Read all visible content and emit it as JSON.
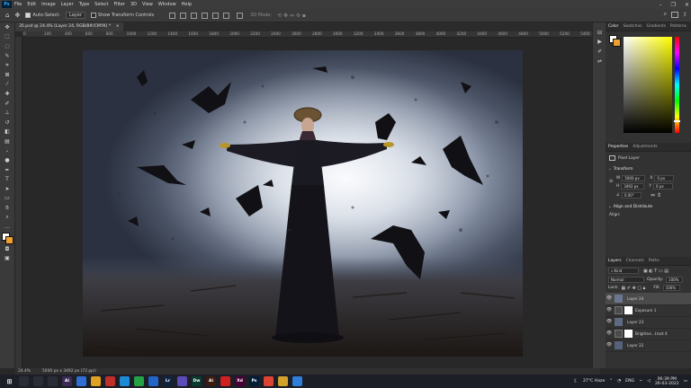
{
  "app": {
    "logo": "Ps",
    "menu": [
      "File",
      "Edit",
      "Image",
      "Layer",
      "Type",
      "Select",
      "Filter",
      "3D",
      "View",
      "Window",
      "Help"
    ],
    "window_controls": {
      "minimize": "–",
      "maximize": "❐",
      "close": "✕"
    }
  },
  "options_bar": {
    "auto_select_label": "Auto-Select:",
    "auto_select_value": "Layer",
    "show_transform_label": "Show Transform Controls",
    "mode_label": "3D Mode:"
  },
  "document": {
    "tab_title": "35.psd @ 24.4% (Layer 24, RGB/8#/CMYK) *",
    "close_symbol": "×",
    "ruler_labels": [
      "0",
      "200",
      "400",
      "600",
      "800",
      "1000",
      "1200",
      "1400",
      "1600",
      "1800",
      "2000",
      "2200",
      "2400",
      "2600",
      "2800",
      "3000",
      "3200",
      "3400",
      "3600",
      "3800",
      "4000",
      "4200",
      "4400",
      "4600",
      "4800",
      "5000",
      "5200",
      "5400"
    ]
  },
  "status": {
    "zoom": "24.4%",
    "size": "5000 px x 3492 px (72 ppi)"
  },
  "color_panel": {
    "tabs": [
      "Color",
      "Swatches",
      "Gradients",
      "Patterns"
    ],
    "fg_color": "#ffffff",
    "bg_color": "#f0a030",
    "hue_color": "#ffff00"
  },
  "properties_panel": {
    "tabs": [
      "Properties",
      "Adjustments"
    ],
    "layer_kind": "Pixel Layer",
    "transform_label": "Transform",
    "w_label": "W",
    "w_value": "5000 px",
    "h_label": "H",
    "h_value": "3492 px",
    "x_label": "X",
    "x_value": "0 px",
    "y_label": "Y",
    "y_value": "0 px",
    "angle_value": "0.00°",
    "align_label": "Align and Distribute",
    "align_sub": "Align:"
  },
  "layers_panel": {
    "tabs": [
      "Layers",
      "Channels",
      "Paths"
    ],
    "kind_label": "Kind",
    "blend_mode": "Normal",
    "opacity_label": "Opacity:",
    "opacity_value": "100%",
    "lock_label": "Lock:",
    "fill_label": "Fill:",
    "fill_value": "100%",
    "layers": [
      {
        "name": "Layer 24",
        "selected": true
      },
      {
        "name": "Exposure 1",
        "selected": false
      },
      {
        "name": "Layer 23",
        "selected": false
      },
      {
        "name": "Brightne...trast 4",
        "selected": false
      },
      {
        "name": "Layer 22",
        "selected": false
      }
    ]
  },
  "taskbar": {
    "apps": [
      {
        "label": "",
        "color": "#2a2d36"
      },
      {
        "label": "",
        "color": "#2a2d36"
      },
      {
        "label": "",
        "color": "#2a2d36"
      },
      {
        "label": "Ai",
        "color": "#3a2a55"
      },
      {
        "label": "",
        "color": "#2f6fd3"
      },
      {
        "label": "",
        "color": "#e0a020"
      },
      {
        "label": "",
        "color": "#c0302a"
      },
      {
        "label": "",
        "color": "#1c8bd6"
      },
      {
        "label": "",
        "color": "#25a244"
      },
      {
        "label": "",
        "color": "#2364c9"
      },
      {
        "label": "Lr",
        "color": "#0f2340"
      },
      {
        "label": "",
        "color": "#5b4bb8"
      },
      {
        "label": "Dw",
        "color": "#0a3a2e"
      },
      {
        "label": "Ai",
        "color": "#3a1c10"
      },
      {
        "label": "",
        "color": "#d02020"
      },
      {
        "label": "Xd",
        "color": "#470137"
      },
      {
        "label": "Ps",
        "color": "#001e36"
      },
      {
        "label": "",
        "color": "#dd4433"
      },
      {
        "label": "",
        "color": "#d2a12a"
      },
      {
        "label": "",
        "color": "#2e7dd8"
      }
    ],
    "weather": "27°C  Haze",
    "language": "ENG",
    "time": "06:39 PM",
    "date": "26-03-2022"
  }
}
